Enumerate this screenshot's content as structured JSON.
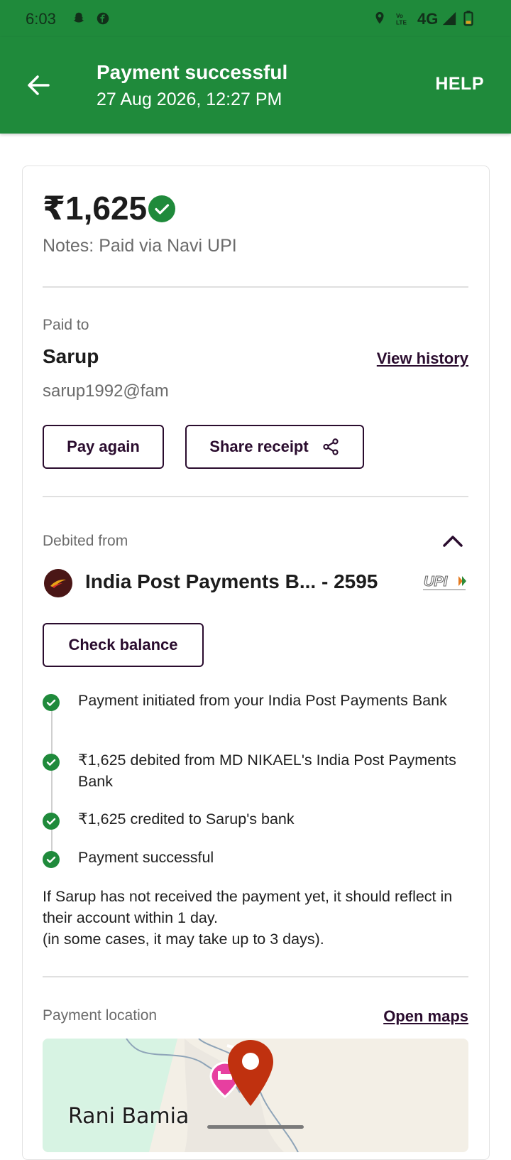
{
  "status_bar": {
    "time": "6:03",
    "network": "4G"
  },
  "header": {
    "title": "Payment successful",
    "datetime": "27 Aug 2026, 12:27 PM",
    "help_label": "HELP"
  },
  "summary": {
    "amount": "₹1,625",
    "notes": "Notes: Paid via Navi UPI"
  },
  "payee": {
    "section_label": "Paid to",
    "name": "Sarup",
    "view_history_label": "View history",
    "vpa": "sarup1992@fam",
    "pay_again_label": "Pay again",
    "share_receipt_label": "Share receipt"
  },
  "debit": {
    "section_label": "Debited from",
    "bank_name": "India Post Payments B... - 2595",
    "check_balance_label": "Check balance"
  },
  "steps": [
    {
      "text": "Payment initiated from your India Post Payments Bank"
    },
    {
      "text": "₹1,625 debited from MD NIKAEL's India Post Payments Bank"
    },
    {
      "text": "₹1,625 credited to Sarup's bank"
    },
    {
      "text": "Payment successful"
    }
  ],
  "info": {
    "line1": "If Sarup has not received the payment yet, it should reflect in their account within 1 day.",
    "line2": "(in some cases, it may take up to 3 days)."
  },
  "location": {
    "section_label": "Payment location",
    "open_maps_label": "Open maps",
    "map_place": "Rani Bamia"
  },
  "colors": {
    "brand_green": "#1f8a3b",
    "accent_dark": "#2a0c2e",
    "check_green": "#1f8a3b",
    "pin_red": "#c0310f"
  }
}
